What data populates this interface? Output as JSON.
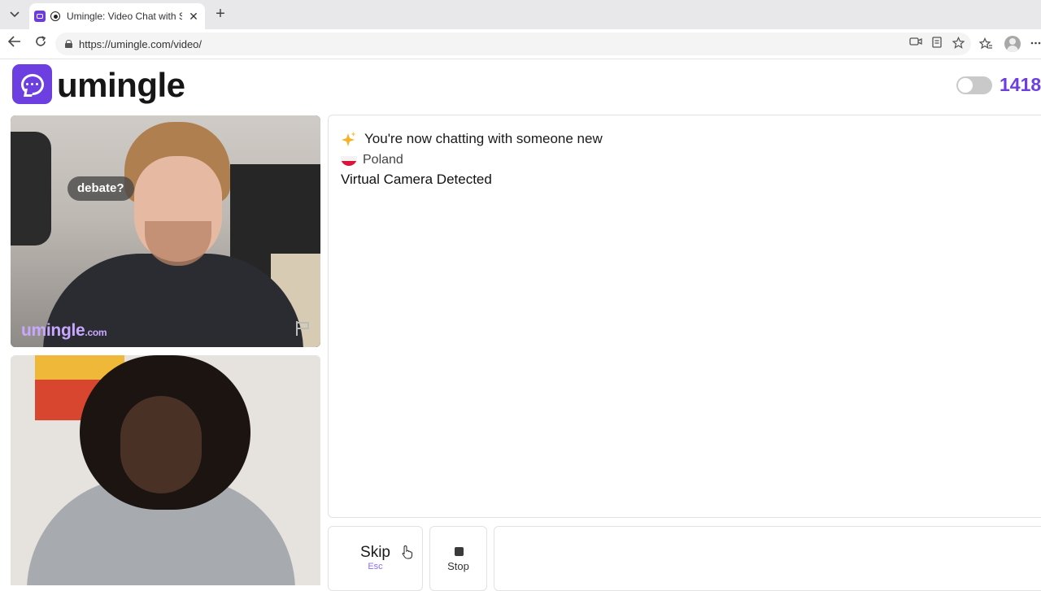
{
  "browser": {
    "tab_title": "Umingle: Video Chat with Stra",
    "tab_close": "✕",
    "new_tab": "+",
    "url": "https://umingle.com/video/"
  },
  "header": {
    "logo_text": "umingle",
    "online_count": "1418",
    "toggle_on": false
  },
  "stranger_video": {
    "caption": "debate?",
    "watermark_main": "umingle",
    "watermark_suffix": ".com"
  },
  "chat": {
    "system_message": "You're now chatting with someone new",
    "country": "Poland",
    "notice": "Virtual Camera Detected"
  },
  "controls": {
    "skip_label": "Skip",
    "skip_hint": "Esc",
    "stop_label": "Stop"
  },
  "colors": {
    "brand": "#6d3fe0",
    "hint": "#8e6cf0"
  }
}
